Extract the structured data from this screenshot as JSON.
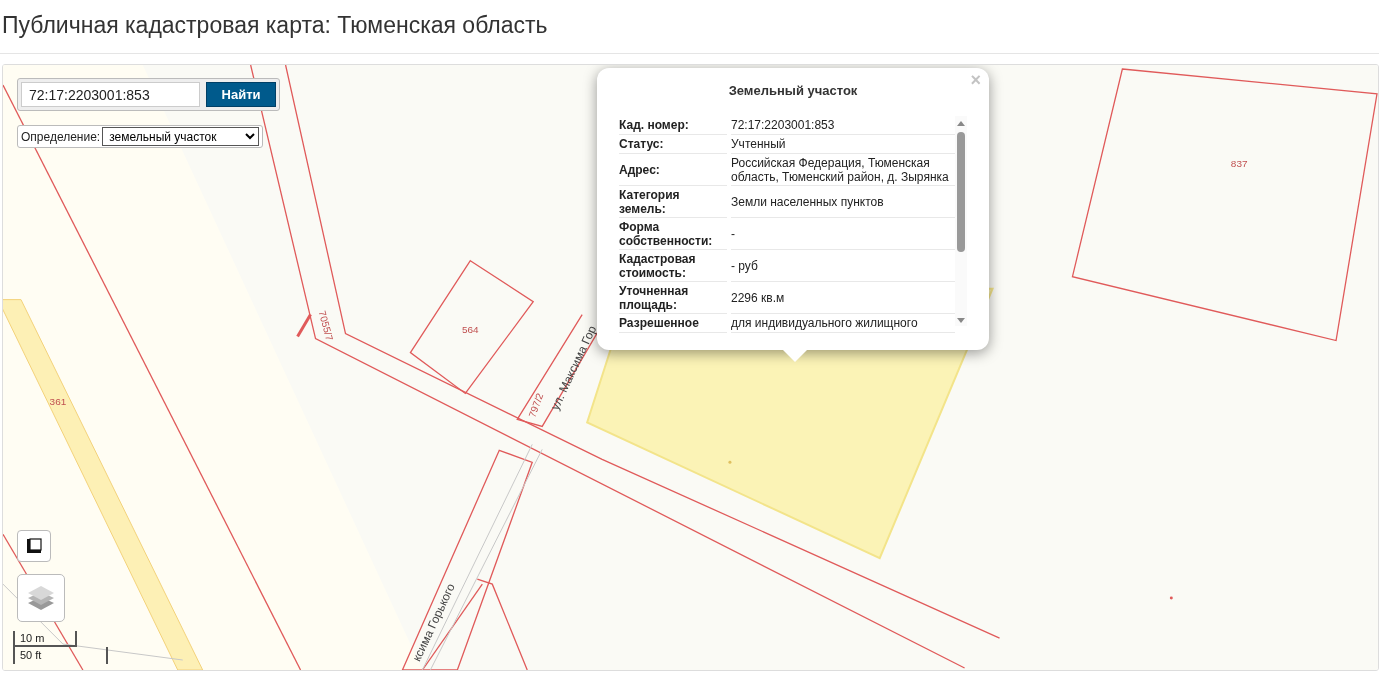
{
  "page": {
    "title": "Публичная кадастровая карта: Тюменская область"
  },
  "search": {
    "value": "72:17:2203001:853",
    "button": "Найти"
  },
  "definition": {
    "label": "Определение:",
    "value": "земельный участок"
  },
  "map_labels": [
    {
      "kind": "parcel",
      "text": "837"
    },
    {
      "kind": "parcel",
      "text": "564"
    },
    {
      "kind": "parcel",
      "text": "7055/7"
    },
    {
      "kind": "parcel",
      "text": "361"
    },
    {
      "kind": "parcel",
      "text": "797/2"
    },
    {
      "kind": "street",
      "text": "ул. Максима Гор"
    },
    {
      "kind": "street",
      "text": "ксима Горького"
    }
  ],
  "popup": {
    "title": "Земельный участок",
    "close": "×",
    "rows": [
      {
        "label": "Кад. номер:",
        "value": "72:17:2203001:853"
      },
      {
        "label": "Статус:",
        "value": "Учтенный"
      },
      {
        "label": "Адрес:",
        "value": "Российская Федерация, Тюменская область, Тюменский район, д. Зырянка"
      },
      {
        "label": "Категория земель:",
        "value": "Земли населенных пунктов"
      },
      {
        "label": "Форма собственности:",
        "value": "-"
      },
      {
        "label": "Кадастровая стоимость:",
        "value": "- руб"
      },
      {
        "label": "Уточненная площадь:",
        "value": "2296 кв.м"
      },
      {
        "label": "Разрешенное",
        "value": "для индивидуального жилищного"
      }
    ]
  },
  "scale": {
    "metric": "10 m",
    "imperial": "50 ft"
  }
}
